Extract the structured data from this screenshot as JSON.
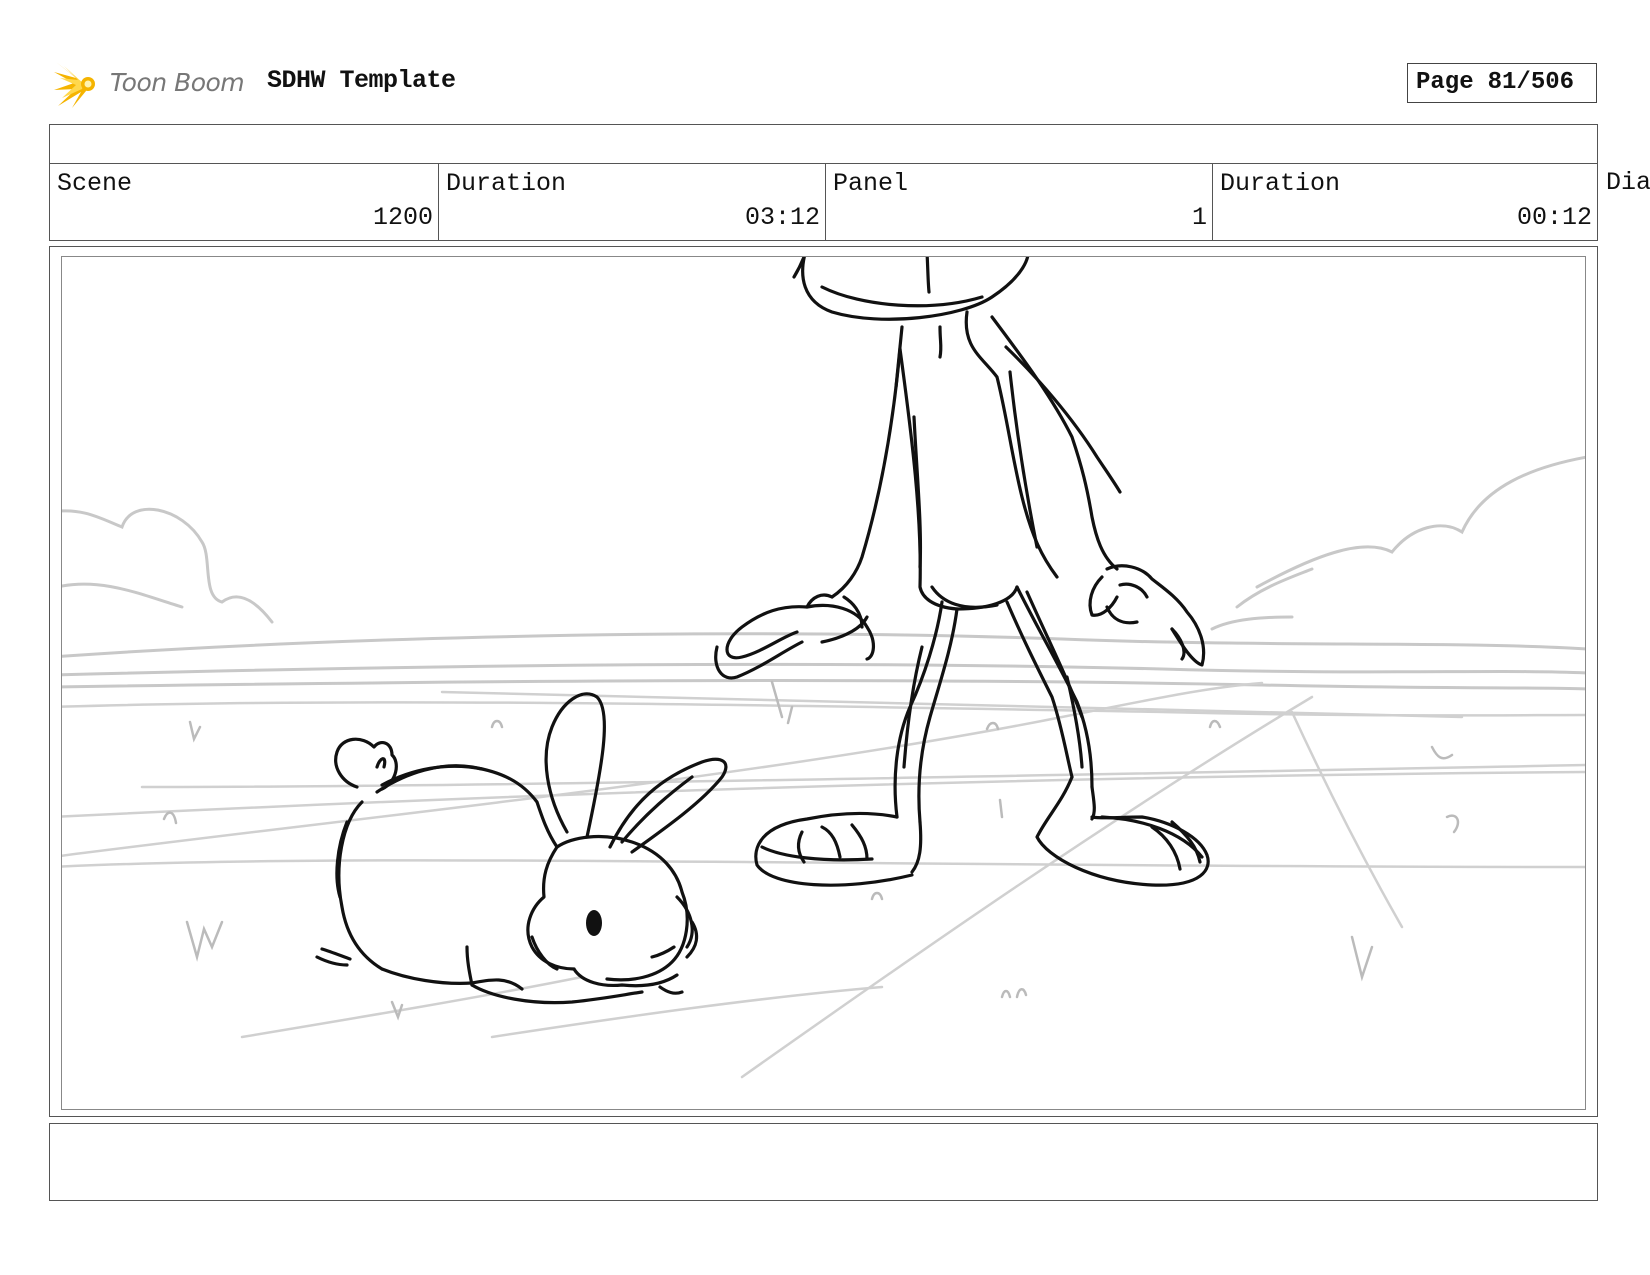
{
  "header": {
    "logo_text": "Toon Boom",
    "title": "SDHW Template",
    "page_label": "Page",
    "page_value": "81/506"
  },
  "info": {
    "cells": [
      {
        "label": "Scene",
        "value": "1200"
      },
      {
        "label": "Duration",
        "value": "03:12"
      },
      {
        "label": "Panel",
        "value": "1"
      },
      {
        "label": "Duration",
        "value": "00:12"
      }
    ],
    "overflow_label": "Dia"
  },
  "panel": {
    "description": "",
    "ink_color": "#111111",
    "background_line_color": "#c8c8c8"
  },
  "notes": {
    "text": ""
  }
}
